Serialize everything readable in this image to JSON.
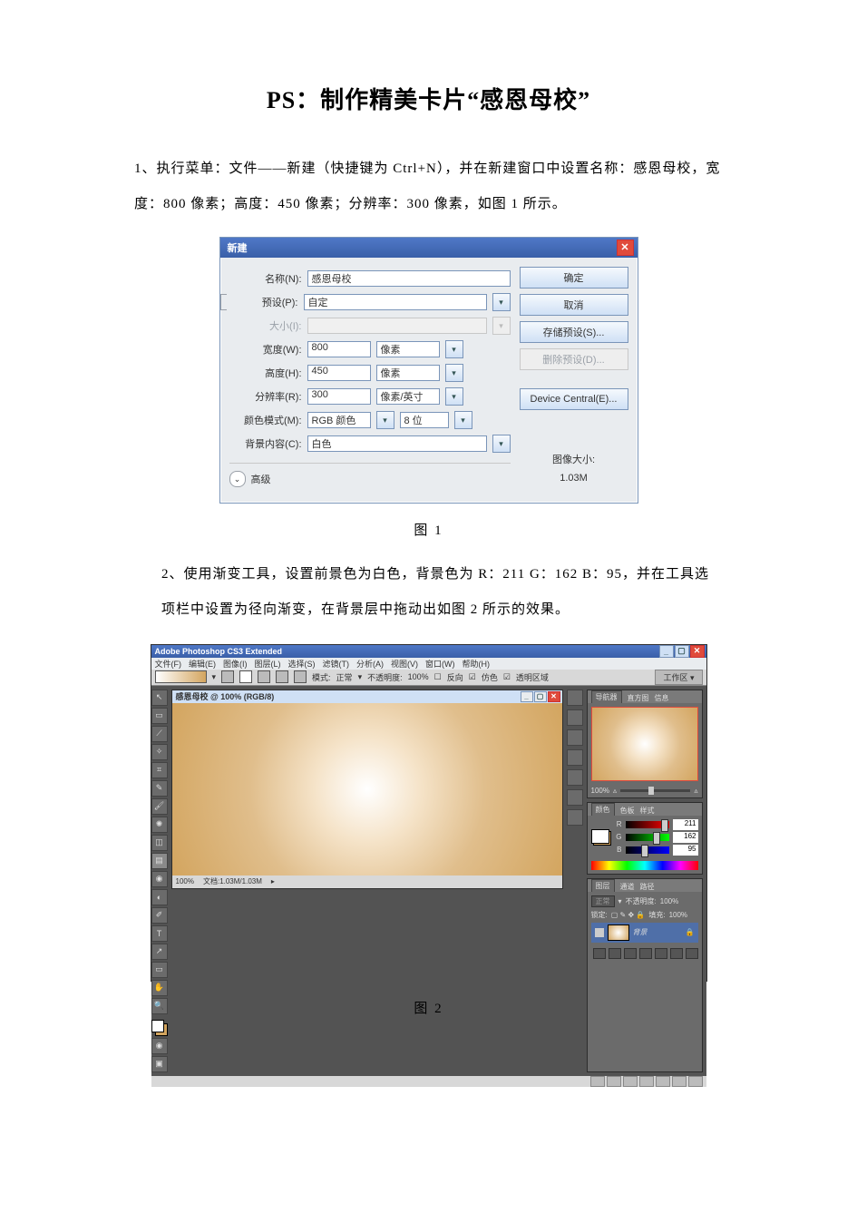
{
  "doc": {
    "title_prefix": "PS：",
    "title_main": "制作精美卡片“感恩母校”",
    "para1": "1、执行菜单：文件——新建（快捷键为 Ctrl+N），并在新建窗口中设置名称：感恩母校，宽度：800 像素；高度：450 像素；分辨率：300 像素，如图 1 所示。",
    "caption1": "图 1",
    "para2": "2、使用渐变工具，设置前景色为白色，背景色为 R：211 G：162 B：95，并在工具选项栏中设置为径向渐变，在背景层中拖动出如图 2 所示的效果。",
    "caption2": "图 2"
  },
  "dialog": {
    "title": "新建",
    "labels": {
      "name": "名称(N):",
      "preset": "预设(P):",
      "size": "大小(I):",
      "width": "宽度(W):",
      "height": "高度(H):",
      "resolution": "分辨率(R):",
      "color_mode": "颜色模式(M):",
      "bg": "背景内容(C):",
      "advanced": "高级"
    },
    "values": {
      "name": "感恩母校",
      "preset": "自定",
      "size": "",
      "width": "800",
      "width_unit": "像素",
      "height": "450",
      "height_unit": "像素",
      "resolution": "300",
      "resolution_unit": "像素/英寸",
      "color_mode": "RGB 颜色",
      "color_depth": "8 位",
      "bg": "白色"
    },
    "buttons": {
      "ok": "确定",
      "cancel": "取消",
      "save_preset": "存储预设(S)...",
      "delete_preset": "删除预设(D)...",
      "device_central": "Device Central(E)..."
    },
    "info": {
      "label": "图像大小:",
      "value": "1.03M"
    }
  },
  "ps": {
    "app_title": "Adobe Photoshop CS3 Extended",
    "menus": [
      "文件(F)",
      "编辑(E)",
      "图像(I)",
      "图层(L)",
      "选择(S)",
      "滤镜(T)",
      "分析(A)",
      "视图(V)",
      "窗口(W)",
      "帮助(H)"
    ],
    "options": {
      "mode_label": "模式:",
      "mode_value": "正常",
      "opacity_label": "不透明度:",
      "opacity_value": "100%",
      "flags": [
        "反向",
        "仿色",
        "透明区域"
      ],
      "workspace": "工作区 ▾"
    },
    "doc": {
      "title": "感恩母校 @ 100% (RGB/8)",
      "zoom": "100%",
      "info": "文档:1.03M/1.03M"
    },
    "panels": {
      "nav_tabs": [
        "导航器",
        "直方图",
        "信息"
      ],
      "nav_zoom": "100%",
      "color_tabs": [
        "颜色",
        "色板",
        "样式"
      ],
      "color": {
        "R": "211",
        "G": "162",
        "B": "95"
      },
      "layers_tabs": [
        "图层",
        "通道",
        "路径"
      ],
      "layers": {
        "blend": "正常",
        "opacity_label": "不透明度:",
        "opacity": "100%",
        "lock_label": "锁定:",
        "fill_label": "填充:",
        "fill": "100%",
        "layer_name": "背景"
      }
    }
  }
}
